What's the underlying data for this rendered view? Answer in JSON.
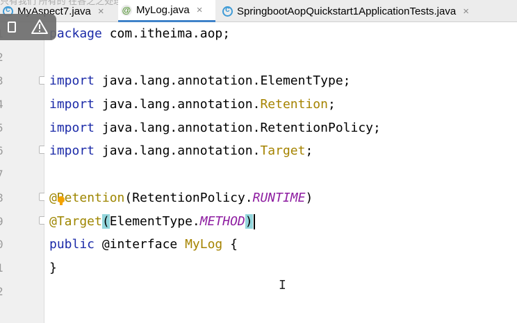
{
  "tabs": [
    {
      "name": "MyAspect7.java",
      "icon": "java-class-icon",
      "active": false
    },
    {
      "name": "MyLog.java",
      "icon": "annotation-icon",
      "active": true
    },
    {
      "name": "SpringbootAopQuickstart1ApplicationTests.java",
      "icon": "java-class-icon",
      "active": false
    }
  ],
  "tab_close_glyph": "×",
  "overlay_text": "只有我们 所有的 在各之之处理",
  "line_numbers": [
    "1",
    "2",
    "3",
    "4",
    "5",
    "6",
    "7",
    "8",
    "9",
    "0",
    "1",
    "2"
  ],
  "code": {
    "line1": {
      "kw": "package",
      "rest": " com.itheima.aop;"
    },
    "line3": {
      "kw": "import",
      "rest": " java.lang.annotation.ElementType;"
    },
    "line4": {
      "kw": "import",
      "mid": " java.lang.annotation.",
      "name": "Retention",
      "end": ";"
    },
    "line5": {
      "kw": "import",
      "rest": " java.lang.annotation.RetentionPolicy;"
    },
    "line6": {
      "kw": "import",
      "mid": " java.lang.annotation.",
      "name": "Target",
      "end": ";"
    },
    "line8": {
      "ann_at": "@",
      "ann_name": "Retention",
      "open": "(",
      "type": "RetentionPolicy.",
      "const": "RUNTIME",
      "close": ")"
    },
    "line9": {
      "ann": "@Target",
      "open": "(",
      "type": "ElementType.",
      "const": "METHOD",
      "close": ")"
    },
    "line10": {
      "kw": "public",
      "mid": " @interface ",
      "name": "MyLog",
      "end": " {"
    },
    "line11": {
      "text": "}"
    }
  },
  "colors": {
    "keyword": "#1b2aa8",
    "annotation": "#9e8600",
    "constant": "#8e1ea1",
    "brace_highlight": "#93d6dc",
    "active_tab_underline": "#4083c9"
  }
}
